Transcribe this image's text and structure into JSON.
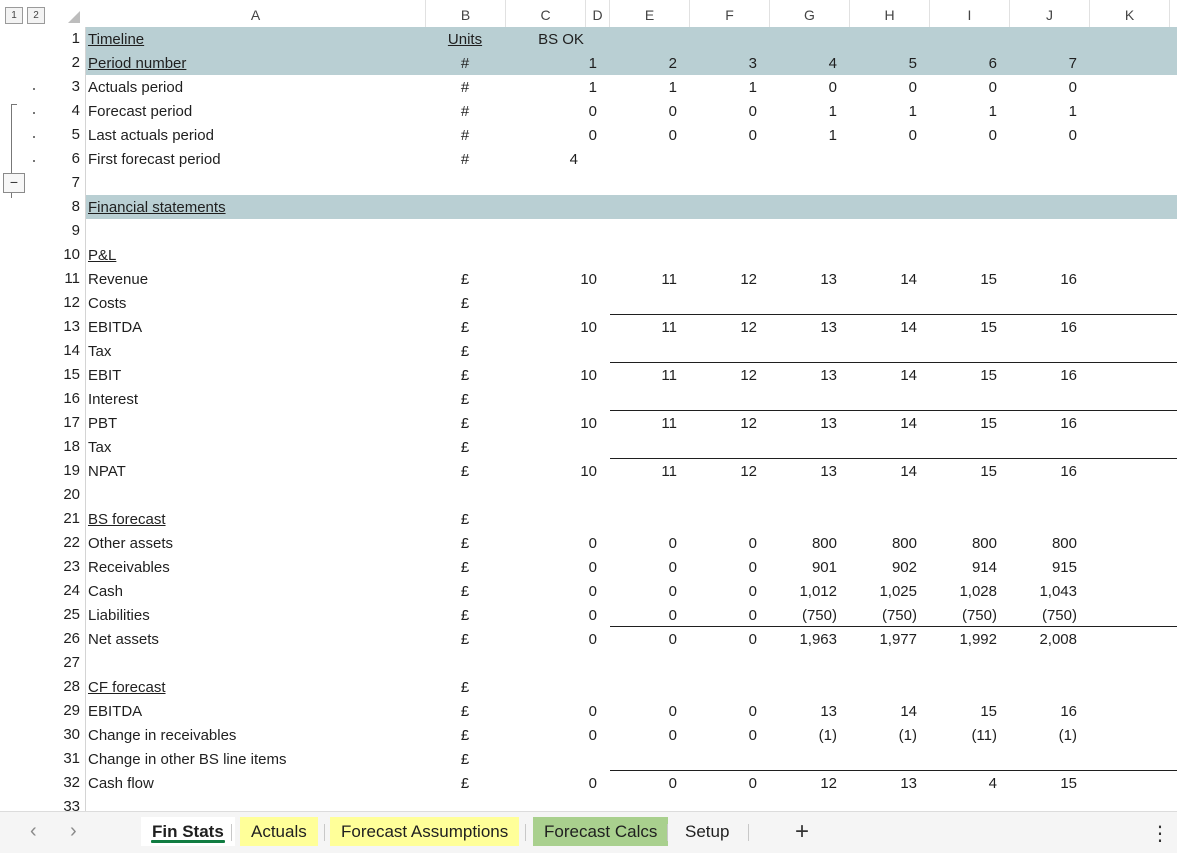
{
  "outline_levels": [
    "1",
    "2"
  ],
  "collapse_symbol": "−",
  "columns": [
    "A",
    "B",
    "C",
    "D",
    "E",
    "F",
    "G",
    "H",
    "I",
    "J",
    "K"
  ],
  "row_numbers": [
    "1",
    "2",
    "3",
    "4",
    "5",
    "6",
    "7",
    "8",
    "9",
    "10",
    "11",
    "12",
    "13",
    "14",
    "15",
    "16",
    "17",
    "18",
    "19",
    "20",
    "21",
    "22",
    "23",
    "24",
    "25",
    "26",
    "27",
    "28",
    "29",
    "30",
    "31",
    "32",
    "33"
  ],
  "rows": {
    "r1": {
      "label": "Timeline",
      "units": "Units",
      "c": "BS OK",
      "vals": [
        "",
        "",
        "",
        "",
        "",
        "",
        ""
      ]
    },
    "r2": {
      "label": "Period number",
      "units": "#",
      "c": "",
      "vals": [
        "1",
        "2",
        "3",
        "4",
        "5",
        "6",
        "7"
      ]
    },
    "r3": {
      "label": "Actuals period",
      "units": "#",
      "c": "",
      "vals": [
        "1",
        "1",
        "1",
        "0",
        "0",
        "0",
        "0"
      ]
    },
    "r4": {
      "label": "Forecast period",
      "units": "#",
      "c": "",
      "vals": [
        "0",
        "0",
        "0",
        "1",
        "1",
        "1",
        "1"
      ]
    },
    "r5": {
      "label": "Last actuals period",
      "units": "#",
      "c": "",
      "vals": [
        "0",
        "0",
        "0",
        "1",
        "0",
        "0",
        "0"
      ]
    },
    "r6": {
      "label": "First forecast period",
      "units": "#",
      "c": "4",
      "vals": [
        "",
        "",
        "",
        "",
        "",
        "",
        ""
      ]
    },
    "r8": {
      "label": "Financial statements",
      "units": "",
      "c": "",
      "vals": [
        "",
        "",
        "",
        "",
        "",
        "",
        ""
      ]
    },
    "r10": {
      "label": "P&L",
      "units": "",
      "c": "",
      "vals": [
        "",
        "",
        "",
        "",
        "",
        "",
        ""
      ]
    },
    "r11": {
      "label": "Revenue",
      "units": "£",
      "c": "",
      "vals": [
        "10",
        "11",
        "12",
        "13",
        "14",
        "15",
        "16"
      ]
    },
    "r12": {
      "label": "Costs",
      "units": "£",
      "c": "",
      "vals": [
        "",
        "",
        "",
        "",
        "",
        "",
        ""
      ]
    },
    "r13": {
      "label": "EBITDA",
      "units": "£",
      "c": "",
      "vals": [
        "10",
        "11",
        "12",
        "13",
        "14",
        "15",
        "16"
      ]
    },
    "r14": {
      "label": "Tax",
      "units": "£",
      "c": "",
      "vals": [
        "",
        "",
        "",
        "",
        "",
        "",
        ""
      ]
    },
    "r15": {
      "label": "EBIT",
      "units": "£",
      "c": "",
      "vals": [
        "10",
        "11",
        "12",
        "13",
        "14",
        "15",
        "16"
      ]
    },
    "r16": {
      "label": "Interest",
      "units": "£",
      "c": "",
      "vals": [
        "",
        "",
        "",
        "",
        "",
        "",
        ""
      ]
    },
    "r17": {
      "label": "PBT",
      "units": "£",
      "c": "",
      "vals": [
        "10",
        "11",
        "12",
        "13",
        "14",
        "15",
        "16"
      ]
    },
    "r18": {
      "label": "Tax",
      "units": "£",
      "c": "",
      "vals": [
        "",
        "",
        "",
        "",
        "",
        "",
        ""
      ]
    },
    "r19": {
      "label": "NPAT",
      "units": "£",
      "c": "",
      "vals": [
        "10",
        "11",
        "12",
        "13",
        "14",
        "15",
        "16"
      ]
    },
    "r21": {
      "label": "BS forecast",
      "units": "£",
      "c": "",
      "vals": [
        "",
        "",
        "",
        "",
        "",
        "",
        ""
      ]
    },
    "r22": {
      "label": "Other assets",
      "units": "£",
      "c": "",
      "vals": [
        "0",
        "0",
        "0",
        "800",
        "800",
        "800",
        "800"
      ]
    },
    "r23": {
      "label": "Receivables",
      "units": "£",
      "c": "",
      "vals": [
        "0",
        "0",
        "0",
        "901",
        "902",
        "914",
        "915"
      ]
    },
    "r24": {
      "label": "Cash",
      "units": "£",
      "c": "",
      "vals": [
        "0",
        "0",
        "0",
        "1,012",
        "1,025",
        "1,028",
        "1,043"
      ]
    },
    "r25": {
      "label": "Liabilities",
      "units": "£",
      "c": "",
      "vals": [
        "0",
        "0",
        "0",
        "(750)",
        "(750)",
        "(750)",
        "(750)"
      ]
    },
    "r26": {
      "label": "Net assets",
      "units": "£",
      "c": "",
      "vals": [
        "0",
        "0",
        "0",
        "1,963",
        "1,977",
        "1,992",
        "2,008"
      ]
    },
    "r28": {
      "label": "CF forecast",
      "units": "£",
      "c": "",
      "vals": [
        "",
        "",
        "",
        "",
        "",
        "",
        ""
      ]
    },
    "r29": {
      "label": "EBITDA",
      "units": "£",
      "c": "",
      "vals": [
        "0",
        "0",
        "0",
        "13",
        "14",
        "15",
        "16"
      ]
    },
    "r30": {
      "label": "Change in receivables",
      "units": "£",
      "c": "",
      "vals": [
        "0",
        "0",
        "0",
        "(1)",
        "(1)",
        "(11)",
        "(1)"
      ]
    },
    "r31": {
      "label": "Change in other BS line items",
      "units": "£",
      "c": "",
      "vals": [
        "",
        "",
        "",
        "",
        "",
        "",
        ""
      ]
    },
    "r32": {
      "label": "Cash flow",
      "units": "£",
      "c": "",
      "vals": [
        "0",
        "0",
        "0",
        "12",
        "13",
        "4",
        "15"
      ]
    }
  },
  "sheet_tabs": [
    {
      "label": "Fin Stats",
      "active": true,
      "color": "#ffffff"
    },
    {
      "label": "Actuals",
      "active": false,
      "color": "#ffff99"
    },
    {
      "label": "Forecast Assumptions",
      "active": false,
      "color": "#ffff99"
    },
    {
      "label": "Forecast Calcs",
      "active": false,
      "color": "#a9d08e"
    },
    {
      "label": "Setup",
      "active": false,
      "color": "#f5f5f5"
    }
  ],
  "add_sheet_symbol": "+",
  "nav_prev_symbol": "‹",
  "nav_next_symbol": "›",
  "more_symbol": "⋮",
  "colors": {
    "header_band": "#b9cfd3",
    "active_tab_underline": "#107c41"
  }
}
